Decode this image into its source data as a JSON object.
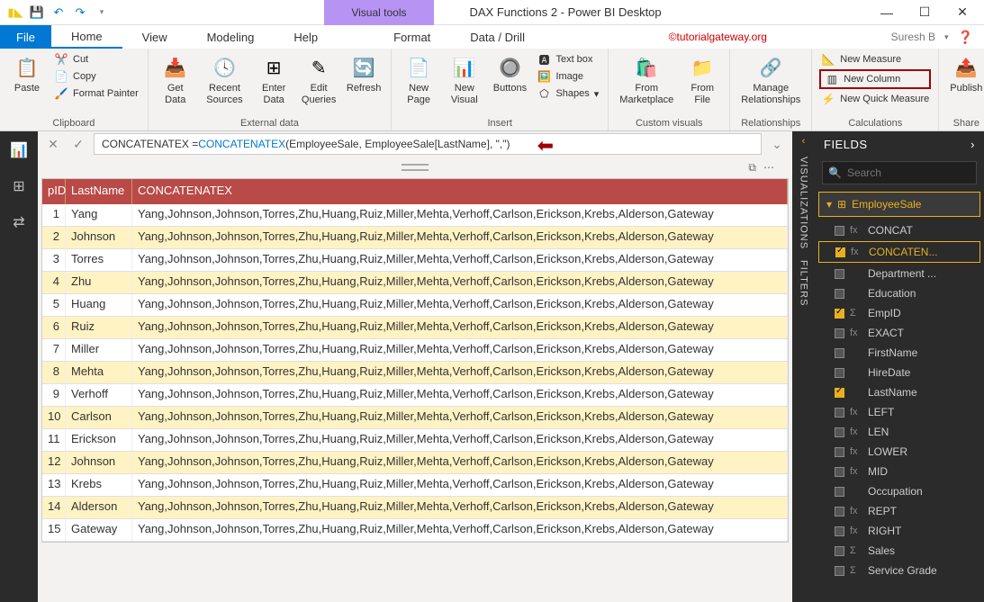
{
  "titlebar": {
    "app_title": "DAX Functions 2 - Power BI Desktop",
    "visual_tools": "Visual tools"
  },
  "tabs": {
    "file": "File",
    "home": "Home",
    "view": "View",
    "modeling": "Modeling",
    "help": "Help",
    "format": "Format",
    "datadrill": "Data / Drill",
    "watermark": "©tutorialgateway.org",
    "user": "Suresh B"
  },
  "ribbon": {
    "paste": "Paste",
    "cut": "Cut",
    "copy": "Copy",
    "format_painter": "Format Painter",
    "clipboard": "Clipboard",
    "get_data": "Get\nData",
    "recent_sources": "Recent\nSources",
    "enter_data": "Enter\nData",
    "edit_queries": "Edit\nQueries",
    "refresh": "Refresh",
    "external_data": "External data",
    "new_page": "New\nPage",
    "new_visual": "New\nVisual",
    "buttons": "Buttons",
    "text_box": "Text box",
    "image": "Image",
    "shapes": "Shapes",
    "insert": "Insert",
    "from_marketplace": "From\nMarketplace",
    "from_file": "From\nFile",
    "custom_visuals": "Custom visuals",
    "manage_relationships": "Manage\nRelationships",
    "relationships": "Relationships",
    "new_measure": "New Measure",
    "new_column": "New Column",
    "new_quick_measure": "New Quick Measure",
    "calculations": "Calculations",
    "publish": "Publish",
    "share": "Share"
  },
  "formula": {
    "prefix": "CONCATENATEX = ",
    "fn": "CONCATENATEX",
    "rest": "(EmployeeSale, EmployeeSale[LastName], \",\")"
  },
  "table": {
    "headers": {
      "id": "pID",
      "lastname": "LastName",
      "concat": "CONCATENATEX"
    },
    "concat_value": "Yang,Johnson,Johnson,Torres,Zhu,Huang,Ruiz,Miller,Mehta,Verhoff,Carlson,Erickson,Krebs,Alderson,Gateway",
    "rows": [
      {
        "id": "1",
        "ln": "Yang"
      },
      {
        "id": "2",
        "ln": "Johnson"
      },
      {
        "id": "3",
        "ln": "Torres"
      },
      {
        "id": "4",
        "ln": "Zhu"
      },
      {
        "id": "5",
        "ln": "Huang"
      },
      {
        "id": "6",
        "ln": "Ruiz"
      },
      {
        "id": "7",
        "ln": "Miller"
      },
      {
        "id": "8",
        "ln": "Mehta"
      },
      {
        "id": "9",
        "ln": "Verhoff"
      },
      {
        "id": "10",
        "ln": "Carlson"
      },
      {
        "id": "11",
        "ln": "Erickson"
      },
      {
        "id": "12",
        "ln": "Johnson"
      },
      {
        "id": "13",
        "ln": "Krebs"
      },
      {
        "id": "14",
        "ln": "Alderson"
      },
      {
        "id": "15",
        "ln": "Gateway"
      }
    ]
  },
  "panels": {
    "visualizations": "VISUALIZATIONS",
    "filters": "FILTERS",
    "fields": "FIELDS",
    "search": "Search"
  },
  "fields": {
    "table_name": "EmployeeSale",
    "items": [
      {
        "name": "CONCAT",
        "checked": false,
        "icon": "fx"
      },
      {
        "name": "CONCATEN...",
        "checked": true,
        "icon": "fx",
        "sel": true
      },
      {
        "name": "Department ...",
        "checked": false,
        "icon": ""
      },
      {
        "name": "Education",
        "checked": false,
        "icon": ""
      },
      {
        "name": "EmpID",
        "checked": true,
        "icon": "Σ"
      },
      {
        "name": "EXACT",
        "checked": false,
        "icon": "fx"
      },
      {
        "name": "FirstName",
        "checked": false,
        "icon": ""
      },
      {
        "name": "HireDate",
        "checked": false,
        "icon": ""
      },
      {
        "name": "LastName",
        "checked": true,
        "icon": ""
      },
      {
        "name": "LEFT",
        "checked": false,
        "icon": "fx"
      },
      {
        "name": "LEN",
        "checked": false,
        "icon": "fx"
      },
      {
        "name": "LOWER",
        "checked": false,
        "icon": "fx"
      },
      {
        "name": "MID",
        "checked": false,
        "icon": "fx"
      },
      {
        "name": "Occupation",
        "checked": false,
        "icon": ""
      },
      {
        "name": "REPT",
        "checked": false,
        "icon": "fx"
      },
      {
        "name": "RIGHT",
        "checked": false,
        "icon": "fx"
      },
      {
        "name": "Sales",
        "checked": false,
        "icon": "Σ"
      },
      {
        "name": "Service Grade",
        "checked": false,
        "icon": "Σ"
      }
    ]
  }
}
